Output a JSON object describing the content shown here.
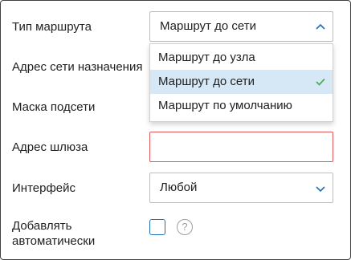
{
  "colors": {
    "accent": "#1e6fb8",
    "check": "#4caf50",
    "error_border": "#e05555",
    "selected_bg": "#d6e8f6"
  },
  "form": {
    "route_type": {
      "label": "Тип маршрута",
      "value": "Маршрут до сети",
      "expanded": true,
      "options": [
        {
          "label": "Маршрут до узла",
          "selected": false
        },
        {
          "label": "Маршрут до сети",
          "selected": true
        },
        {
          "label": "Маршрут по умолчанию",
          "selected": false
        }
      ]
    },
    "destination": {
      "label": "Адрес сети назначения"
    },
    "subnet_mask": {
      "label": "Маска подсети"
    },
    "gateway": {
      "label": "Адрес шлюза",
      "value": "",
      "state": "error"
    },
    "interface": {
      "label": "Интерфейс",
      "value": "Любой"
    },
    "auto_add": {
      "label_line1": "Добавлять",
      "label_line2": "автоматически",
      "checked": false,
      "help_glyph": "?"
    }
  }
}
